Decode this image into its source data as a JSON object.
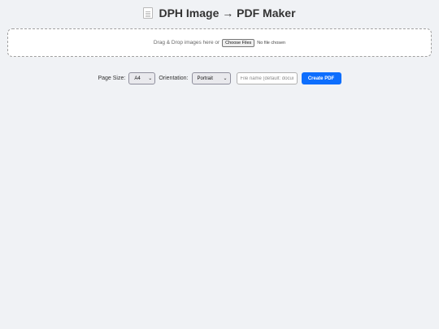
{
  "header": {
    "title": "DPH Image → PDF Maker",
    "icon": "page-facing-up-icon"
  },
  "dropzone": {
    "text": "Drag & Drop images here or",
    "file_button_label": "Choose Files",
    "file_status": "No file chosen"
  },
  "controls": {
    "page_size_label": "Page Size:",
    "page_size_value": "A4",
    "orientation_label": "Orientation:",
    "orientation_value": "Portrait",
    "file_name_placeholder": "File name (default: document)",
    "create_button_label": "Create PDF"
  },
  "colors": {
    "background": "#f0f2f5",
    "accent": "#0d6efd"
  }
}
